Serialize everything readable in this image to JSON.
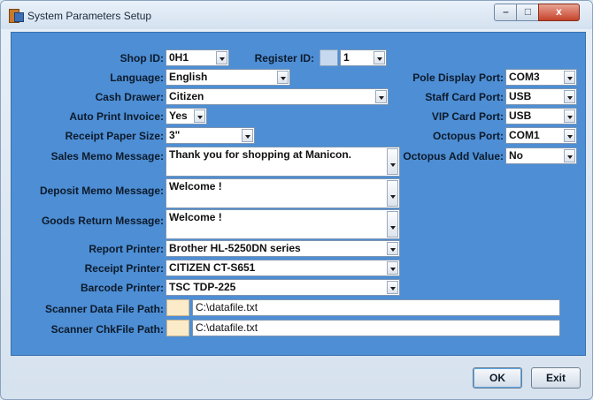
{
  "window": {
    "title": "System Parameters Setup"
  },
  "caption_buttons": {
    "minimize": "–",
    "maximize": "□",
    "close": "x"
  },
  "colors": {
    "panel": "#4d8ed5",
    "swatch": "#fcebc8"
  },
  "form": {
    "shop_id": {
      "label": "Shop ID:",
      "value": "0H1"
    },
    "register_id": {
      "label": "Register ID:",
      "value": "1"
    },
    "language": {
      "label": "Language:",
      "value": "English"
    },
    "cash_drawer": {
      "label": "Cash Drawer:",
      "value": "Citizen"
    },
    "auto_print_invoice": {
      "label": "Auto Print Invoice:",
      "value": "Yes"
    },
    "receipt_paper_size": {
      "label": "Receipt Paper Size:",
      "value": "3\""
    },
    "sales_memo": {
      "label": "Sales Memo Message:",
      "value": "Thank you for shopping at Manicon."
    },
    "deposit_memo": {
      "label": "Deposit Memo Message:",
      "value": "Welcome !"
    },
    "goods_return": {
      "label": "Goods Return Message:",
      "value": "Welcome !"
    },
    "report_printer": {
      "label": "Report Printer:",
      "value": "Brother HL-5250DN series"
    },
    "receipt_printer": {
      "label": "Receipt Printer:",
      "value": "CITIZEN CT-S651"
    },
    "barcode_printer": {
      "label": "Barcode Printer:",
      "value": "TSC TDP-225"
    },
    "scanner_data_path": {
      "label": "Scanner Data File Path:",
      "value": "C:\\datafile.txt"
    },
    "scanner_chk_path": {
      "label": "Scanner ChkFile Path:",
      "value": "C:\\datafile.txt"
    },
    "pole_display_port": {
      "label": "Pole Display Port:",
      "value": "COM3"
    },
    "staff_card_port": {
      "label": "Staff Card Port:",
      "value": "USB"
    },
    "vip_card_port": {
      "label": "VIP Card Port:",
      "value": "USB"
    },
    "octopus_port": {
      "label": "Octopus Port:",
      "value": "COM1"
    },
    "octopus_add_value": {
      "label": "Octopus Add Value:",
      "value": "No"
    }
  },
  "buttons": {
    "ok": "OK",
    "exit": "Exit"
  }
}
